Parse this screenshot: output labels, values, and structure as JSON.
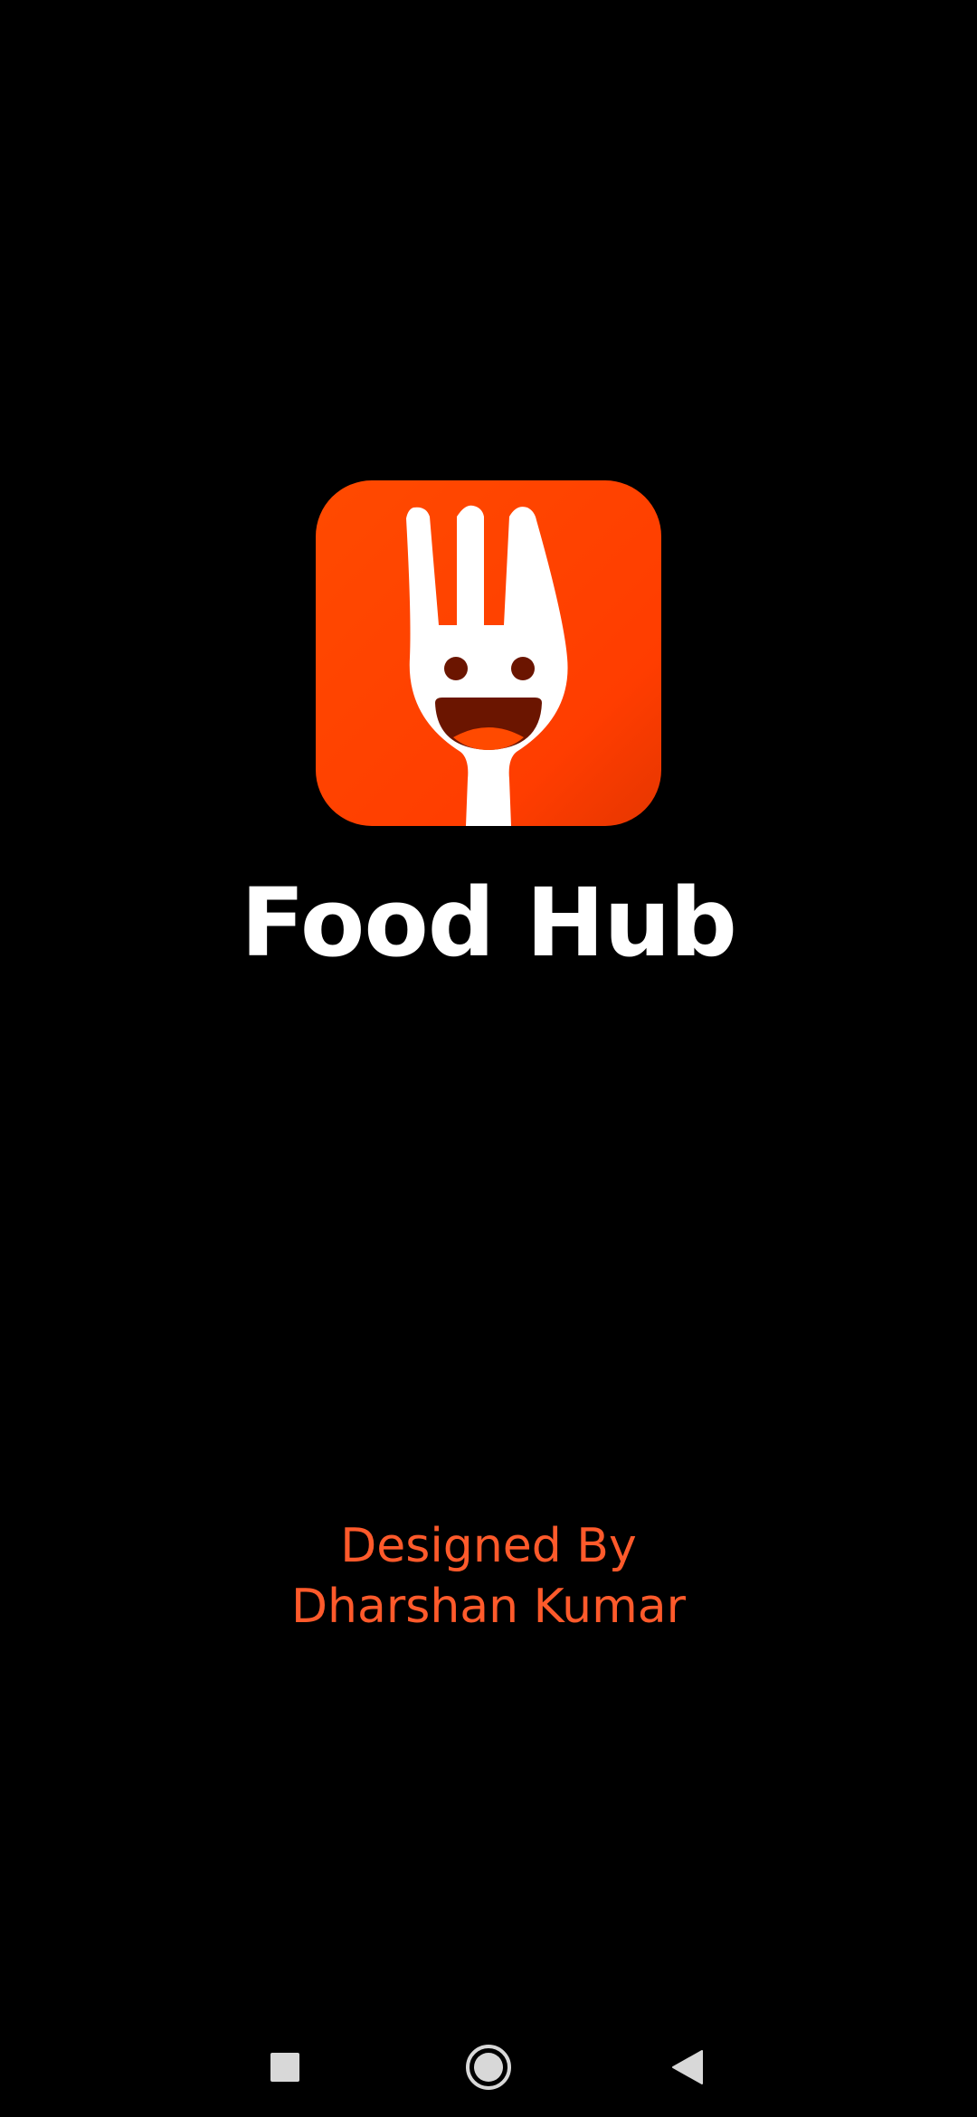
{
  "app": {
    "title": "Food Hub",
    "logo_icon": "fork-smiley-icon",
    "brand_color": "#ff4500",
    "background_color": "#000000"
  },
  "credit": {
    "line1": "Designed By",
    "line2": "Dharshan Kumar",
    "color": "#ff5a2b"
  },
  "navbar": {
    "recents_icon": "square-icon",
    "home_icon": "circle-icon",
    "back_icon": "triangle-back-icon"
  }
}
